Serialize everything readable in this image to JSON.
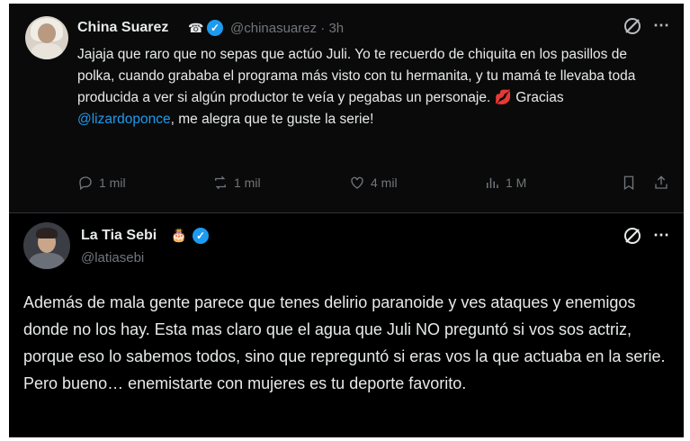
{
  "tweet1": {
    "name": "China Suarez",
    "name_emoji": "☎",
    "handle_time": "@chinasuarez · 3h",
    "text_a": "Jajaja que raro que no sepas que actúo Juli. Yo te recuerdo de chiquita en los pasillos de polka, cuando grababa el programa más visto con tu hermanita, y tu mamá te llevaba toda producida a ver si algún productor te veía y pegabas un personaje.",
    "lips_emoji": "💋",
    "text_b": " Gracias ",
    "mention": "@lizardoponce",
    "text_c": ", me alegra que te guste la serie!",
    "replies": "1 mil",
    "reposts": "1 mil",
    "likes": "4 mil",
    "views": "1 M"
  },
  "tweet2": {
    "name": "La Tia Sebi",
    "name_emoji": "🎂",
    "handle": "@latiasebi",
    "text": "Además de mala gente parece que tenes  delirio paranoide y ves ataques y enemigos donde no los hay. Esta mas claro que el agua que Juli NO preguntó si vos sos actriz, porque eso lo sabemos todos, sino que repreguntó si eras vos la que actuaba en la serie.  Pero bueno… enemistarte con mujeres es tu deporte favorito."
  },
  "icons": {
    "grok": "grok-icon",
    "more": "⋯",
    "verified": "✓"
  },
  "colors": {
    "accent": "#1d9bf0",
    "text": "#e7e9ea",
    "muted": "#71767b"
  }
}
